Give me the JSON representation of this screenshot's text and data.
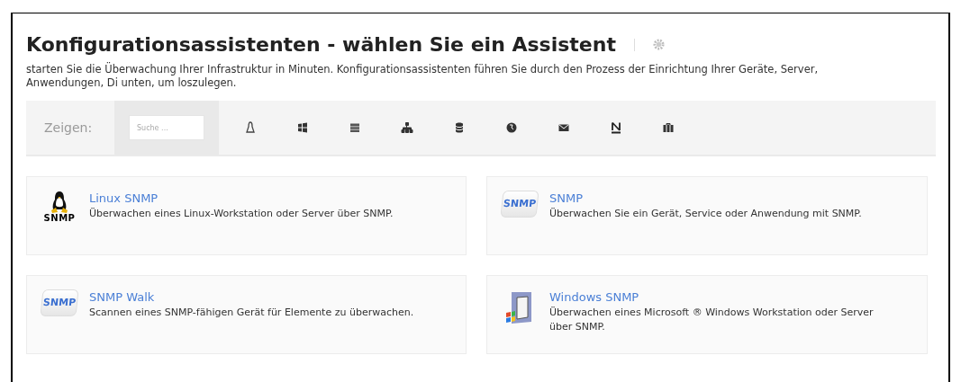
{
  "title": "Konfigurationsassistenten - wählen Sie ein Assistent",
  "description": "starten Sie die Überwachung Ihrer Infrastruktur in Minuten. Konfigurationsassistenten führen Sie durch den Prozess der Einrichtung Ihrer Geräte, Server, Anwendungen, Di unten, um loszulegen.",
  "filter": {
    "label": "Zeigen:",
    "search": {
      "placeholder": "Suche ..."
    }
  },
  "wizards": [
    {
      "kind": "linux",
      "logo_text": "SNMP",
      "name": "Linux SNMP",
      "description": "Überwachen eines Linux-Workstation oder Server über SNMP."
    },
    {
      "kind": "snmp",
      "logo_text": "SNMP",
      "name": "SNMP",
      "description": "Überwachen Sie ein Gerät, Service oder Anwendung mit SNMP."
    },
    {
      "kind": "snmp",
      "logo_text": "SNMP",
      "name": "SNMP Walk",
      "description": "Scannen eines SNMP-fähigen Gerät für Elemente zu überwachen."
    },
    {
      "kind": "windows",
      "name": "Windows SNMP",
      "description": "Überwachen eines Microsoft ® Windows Workstation oder Server über SNMP."
    }
  ]
}
